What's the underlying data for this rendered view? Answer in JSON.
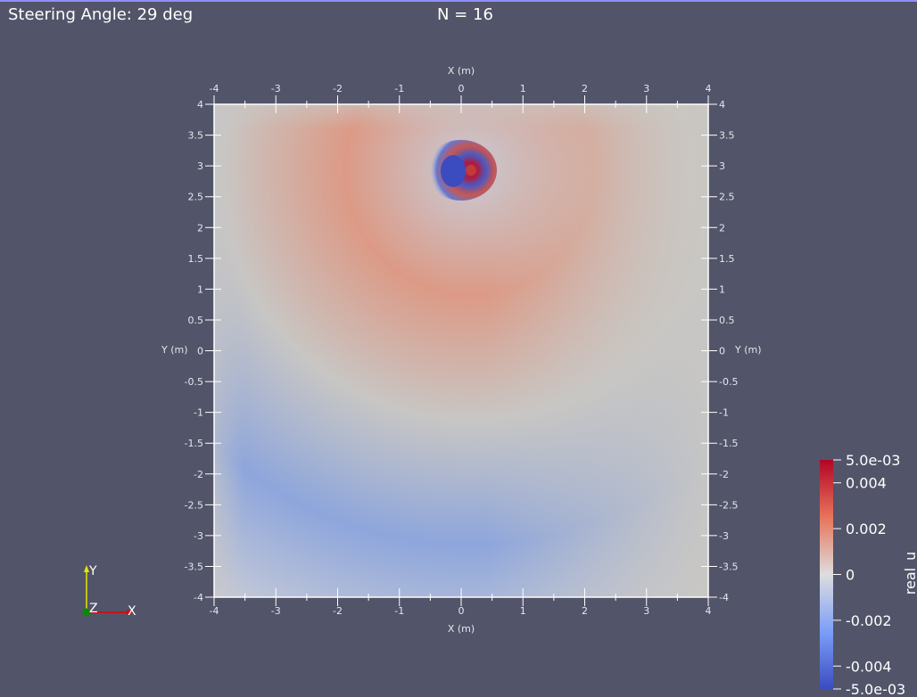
{
  "annotations": {
    "steering": "Steering Angle: 29 deg",
    "n": "N = 16"
  },
  "plot": {
    "x_title": "X (m)",
    "y_title": "Y (m)",
    "x_ticks": [
      "-4",
      "-3",
      "-2",
      "-1",
      "0",
      "1",
      "2",
      "3",
      "4"
    ],
    "y_ticks": [
      "4",
      "3.5",
      "3",
      "2.5",
      "2",
      "1.5",
      "1",
      "0.5",
      "0",
      "-0.5",
      "-1",
      "-1.5",
      "-2",
      "-2.5",
      "-3",
      "-3.5",
      "-4"
    ],
    "x_range": [
      -4,
      4
    ],
    "y_range": [
      -4,
      4
    ],
    "source_position": [
      0.15,
      3
    ]
  },
  "colorbar": {
    "title": "real_u",
    "range": [
      -0.005,
      0.005
    ],
    "labels": [
      "5.0e-03",
      "0.004",
      "0.002",
      "0",
      "-0.002",
      "-0.004",
      "-5.0e-03"
    ],
    "colors": {
      "low": "#3b4cc0",
      "mid": "#dddddd",
      "high": "#b40426"
    }
  },
  "triad": {
    "y": "Y",
    "z": "Z",
    "x": "X"
  },
  "colors": {
    "background": "#525469",
    "accent_line": "#8f90ff"
  }
}
